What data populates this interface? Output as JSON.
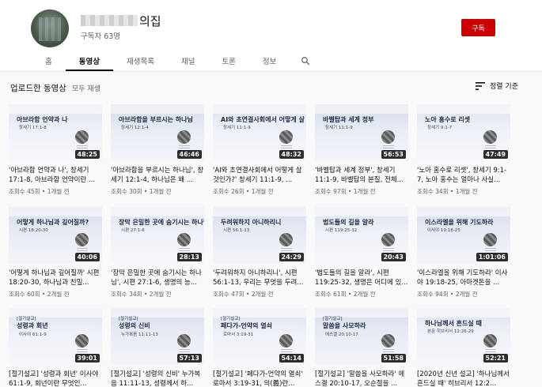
{
  "channel": {
    "name_suffix": "의집",
    "subscribers": "구독자 63명",
    "subscribe_label": "구독"
  },
  "tabs": [
    {
      "label": "홈",
      "active": false
    },
    {
      "label": "동영상",
      "active": true
    },
    {
      "label": "재생목록",
      "active": false
    },
    {
      "label": "채널",
      "active": false
    },
    {
      "label": "토론",
      "active": false
    },
    {
      "label": "정보",
      "active": false
    }
  ],
  "icons": {
    "search": "search-icon",
    "sort": "sort-icon"
  },
  "toolbar": {
    "section_title": "업로드한 동영상",
    "play_all": "모두 재생",
    "sort_label": "정렬 기준"
  },
  "colors": {
    "subscribe": "#cc0000",
    "duration_bg": "#000000"
  },
  "videos": [
    {
      "thumb_title": "아브라함 언약과 나",
      "thumb_sub": "창세기 17:1-8",
      "duration": "48:25",
      "title": "'아브라함 언약과 나', 창세기 17:1-8, 아브라함 언약이란 ...",
      "meta": "조회수 45회 • 1개월 전"
    },
    {
      "thumb_title": "아브라함을 부르시는 하나님",
      "thumb_sub": "창세기 12:1-4",
      "duration": "46:46",
      "title": "'아브라함을 부르시는 하나님', 창세기 12:1-4, 하나님은 왜 ...",
      "meta": "조회수 30회 • 1개월 전"
    },
    {
      "thumb_title": "AI와 초연결사회에서 어떻게 살 것인가?",
      "thumb_sub": "창세기 11:1-9",
      "duration": "48:32",
      "title": "'AI와 초연결사회에서 어떻게 살 것인가?' 창세기 11:1-9, ...",
      "meta": "조회수 26회 • 1개월 전"
    },
    {
      "thumb_title": "바벨탑과 세계 정부",
      "thumb_sub": "창세기 11:1-9",
      "duration": "56:53",
      "title": "'바벨탑과 세계 정부', 창세기 11:1-9, 바벨탑의 본질, 전체...",
      "meta": "조회수 97회 • 1개월 전"
    },
    {
      "thumb_title": "노아 홍수로 리셋",
      "thumb_sub": "창세기 9:1-7",
      "duration": "47:49",
      "title": "'노아 홍수로 리셋', 창세기 9:1-7, 노아 홍수는 얼마나 사실...",
      "meta": "조회수 34회 • 1개월 전"
    },
    {
      "thumb_title": "어떻게 하나님과 깊어질까?",
      "thumb_sub": "시편 18:20-30",
      "duration": "40:06",
      "title": "'어떻게 하나님과 깊어질까' 시편 18:20-30, 하나님과 친밀...",
      "meta": "조회수 60회 • 2개월 전"
    },
    {
      "thumb_title": "장막 은밀한 곳에 숨기시는 하나님",
      "thumb_sub": "시편 27:1-6",
      "duration": "28:13",
      "title": "'장막 은밀한 곳에 숨기시는 하나님', 시편 27:1-6, 생명의 능...",
      "meta": "조회수 34회 • 2개월 전"
    },
    {
      "thumb_title": "두려워하지 아니하리니",
      "thumb_sub": "시편 56:1-13",
      "duration": "24:29",
      "title": "'두려워하지 아니하리니', 시편 56:1-13, 우리는 무엇을 두려...",
      "meta": "조회수 47회 • 2개월 전"
    },
    {
      "thumb_title": "법도들의 길을 알라",
      "thumb_sub": "시편 119:25-32",
      "duration": "20:43",
      "title": "'법도들의 길을 알라', 시편 119:25-32, 생명은 어디에 있...",
      "meta": "조회수 61회 • 2개월 전"
    },
    {
      "thumb_title": "이스라엘을 위해 기도하라",
      "thumb_sub": "이사야 19:18-25",
      "duration": "1:01:06",
      "title": "'이스라엘을 위해 기도하라' 이사야 19:18-25, 아마겟돈을 ...",
      "meta": "조회수 94회 • 2개월 전"
    },
    {
      "series": "[절기설교]",
      "thumb_title": "성령과 회년",
      "thumb_sub": "이사야 61:1-9",
      "duration": "39:01",
      "title": "[절기설교] '성령과 회년' 이사야 61:1-9, 회년이란 무엇인...",
      "meta": "조회수 50회 • 2개월 전"
    },
    {
      "series": "[절기설교]",
      "thumb_title": "성령의 신비",
      "thumb_sub": "누가복음 11:11-13",
      "duration": "57:13",
      "title": "[절기설교] '성령의 신비' 누가복음 11:11-13, 성령께서 하...",
      "meta": "조회수 43회 • 2개월 전"
    },
    {
      "series": "[절기설교]",
      "thumb_title": "페다가-언약의 열쇠",
      "thumb_sub": "로마서 3:19-31",
      "duration": "54:14",
      "title": "[절기설교] '페다가-언약의 열쇠' 로마서 3:19-31, 의(義)란...",
      "meta": "조회수 32회 • 3개월 전"
    },
    {
      "series": "[절기설교]",
      "thumb_title": "말씀을 사모하라",
      "thumb_sub": "에스겔 20:10-17",
      "duration": "51:58",
      "title": "[절기설교] '말씀을 사모하라' 에스겔 20:10-17, 오순절을 ...",
      "meta": "조회수 58회 • 3개월 전"
    },
    {
      "thumb_title": "하나님께서 흔드실 때",
      "thumb_sub": "본문 히브리서 12:26-29",
      "duration": "52:21",
      "title": "[2020년 신년 설교] '하나님께서 흔드실 때' 히브리서 12:2...",
      "meta": ""
    }
  ]
}
